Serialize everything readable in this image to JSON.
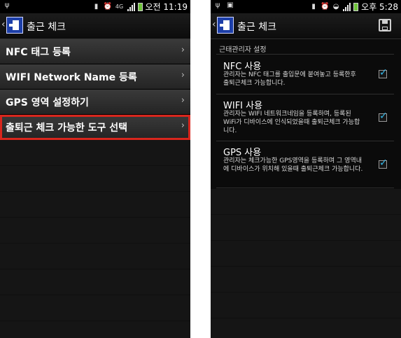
{
  "left": {
    "status": {
      "network": "4G",
      "time": "오전 11:19"
    },
    "actionbar": {
      "title": "출근 체크"
    },
    "menu": [
      {
        "label": "NFC 태그 등록"
      },
      {
        "label": "WIFI Network Name 등록"
      },
      {
        "label": "GPS 영역 설정하기"
      },
      {
        "label": "출퇴근 체크 가능한 도구 선택",
        "selected": true
      }
    ],
    "chevron": "›"
  },
  "right": {
    "status": {
      "time": "오후 5:28"
    },
    "actionbar": {
      "title": "출근 체크"
    },
    "section_header": "근태관리자 설정",
    "prefs": [
      {
        "title": "NFC 사용",
        "summary": "관리자는 NFC 태그를 출입문에 붙여놓고 등록한후 출퇴근체크 가능합니다.",
        "checked": true
      },
      {
        "title": "WIFI 사용",
        "summary": "관리자는 WIFI 네트워크네임을 등록하며, 등록된 WiFi가 디바이스에 인식되었을때 출퇴근체크 가능합니다.",
        "checked": true
      },
      {
        "title": "GPS 사용",
        "summary": "관리자는 체크가능한 GPS영역을 등록하며 그 영역내에 디바이스가 위치해 있을때 출퇴근체크 가능합니다.",
        "checked": true
      }
    ]
  },
  "colors": {
    "accent": "#33b5e5",
    "selection_outline": "#d8261d",
    "app_icon": "#1d3fa8"
  }
}
